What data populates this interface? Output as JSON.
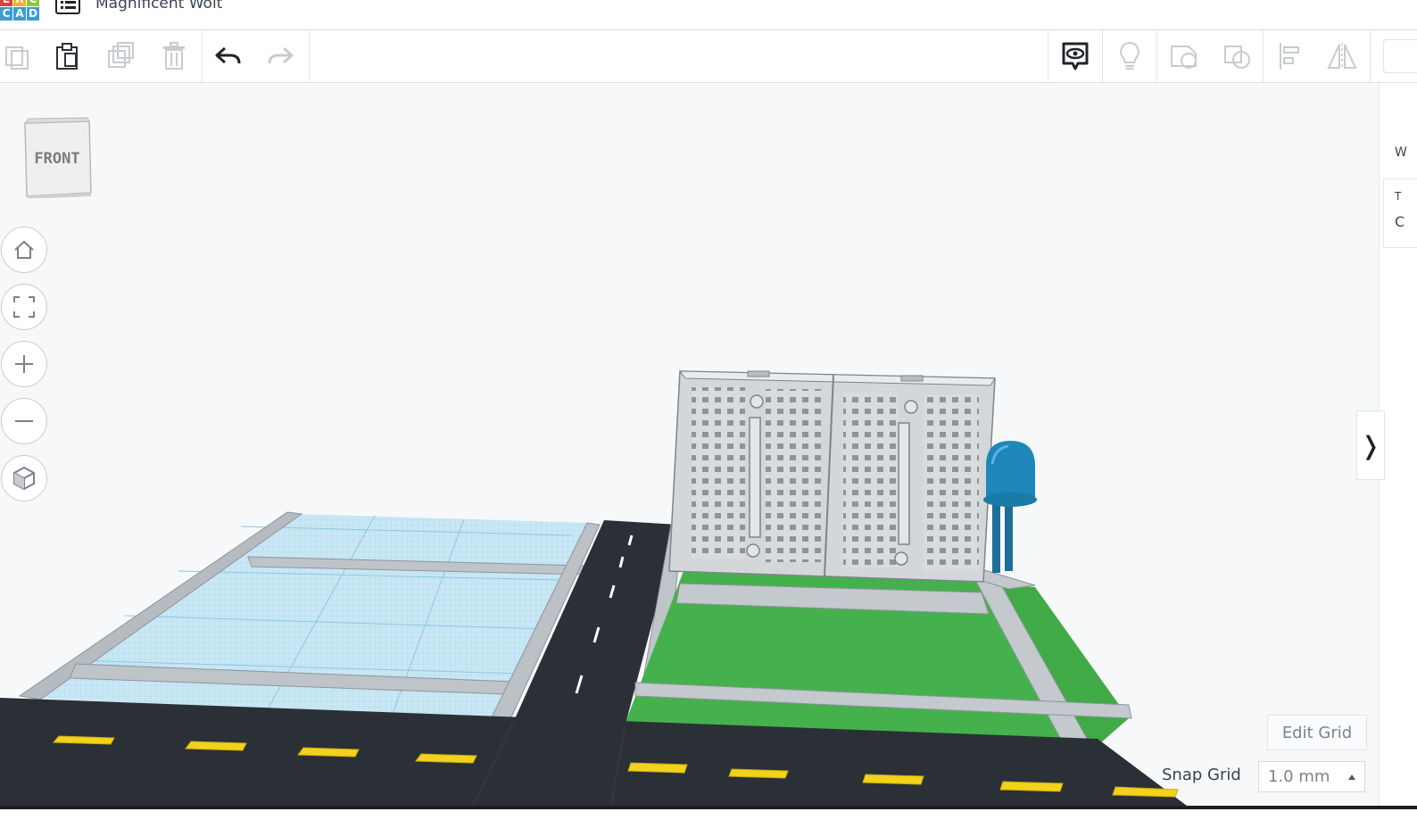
{
  "header": {
    "logo_letters": [
      "E",
      "R",
      "C",
      "A",
      "D"
    ],
    "design_name": "Magnificent Wolt"
  },
  "toolbar": {
    "buttons": [
      "copy",
      "paste",
      "duplicate",
      "delete",
      "undo",
      "redo"
    ],
    "right_buttons": [
      "notes",
      "light",
      "shape-group",
      "shape-ungroup",
      "align",
      "mirror"
    ]
  },
  "viewcube": {
    "label": "FRONT"
  },
  "nav": [
    "home",
    "fit",
    "zoom-in",
    "zoom-out",
    "perspective"
  ],
  "grid": {
    "edit_label": "Edit Grid",
    "snap_label": "Snap Grid",
    "snap_value": "1.0 mm"
  },
  "panel_fragment": {
    "line1": "W",
    "line2": "T",
    "line3": "C"
  },
  "collapse_glyph": "❭",
  "colors": {
    "road": "#2b2f36",
    "grass": "#45b14c",
    "water_grid": "#bfe2f1",
    "sidewalk": "#b9bec4",
    "yellow_line": "#f2d21b",
    "led_blue": "#1e86b8",
    "breadboard": "#d6d9dc"
  }
}
